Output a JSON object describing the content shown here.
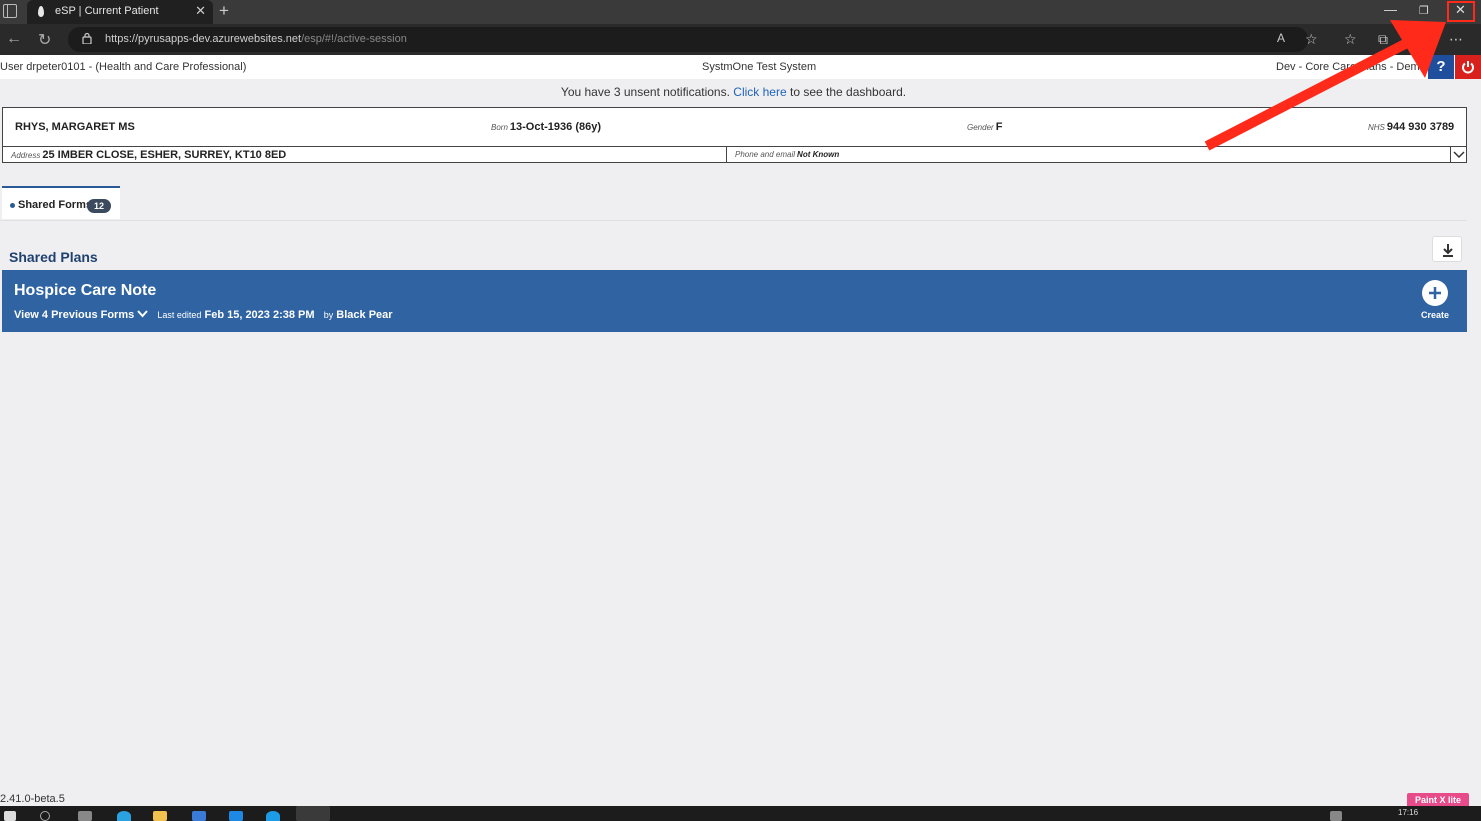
{
  "browser": {
    "tab_title": "eSP | Current Patient",
    "url_host": "https://pyrusapps-dev.azurewebsites.net",
    "url_path": "/esp/#!/active-session"
  },
  "header": {
    "user": "User drpeter0101 - (Health and Care Professional)",
    "system": "SystmOne Test System",
    "environment": "Dev - Core Care Plans - Demo"
  },
  "notification": {
    "prefix": "You have 3 unsent notifications.",
    "link": "Click here",
    "suffix": "to see the dashboard."
  },
  "patient": {
    "name": "RHYS, MARGARET MS",
    "born_label": "Born",
    "born": "13-Oct-1936 (86y)",
    "gender_label": "Gender",
    "gender": "F",
    "nhs_label": "NHS",
    "nhs": "944 930 3789",
    "address_label": "Address",
    "address": "25 IMBER CLOSE, ESHER, SURREY, KT10 8ED",
    "phone_label": "Phone and email",
    "phone": "Not Known"
  },
  "tabs": [
    {
      "label": "Shared Forms",
      "count": "12"
    }
  ],
  "shared_plans": {
    "title": "Shared Plans",
    "card": {
      "title": "Hospice Care Note",
      "previous_forms": "View 4 Previous Forms",
      "last_edited_label": "Last edited",
      "last_edited": "Feb 15, 2023 2:38 PM",
      "by_label": "by",
      "by": "Black Pear",
      "create_label": "Create"
    }
  },
  "footer": {
    "version": "2.41.0-beta.5",
    "paint_badge": "Paint X lite",
    "clock": "17:16"
  },
  "colors": {
    "plan_card": "#2f63a2",
    "help": "#1f4e9c",
    "power": "#d8211c",
    "annotation_arrow": "#ff2a1a"
  }
}
